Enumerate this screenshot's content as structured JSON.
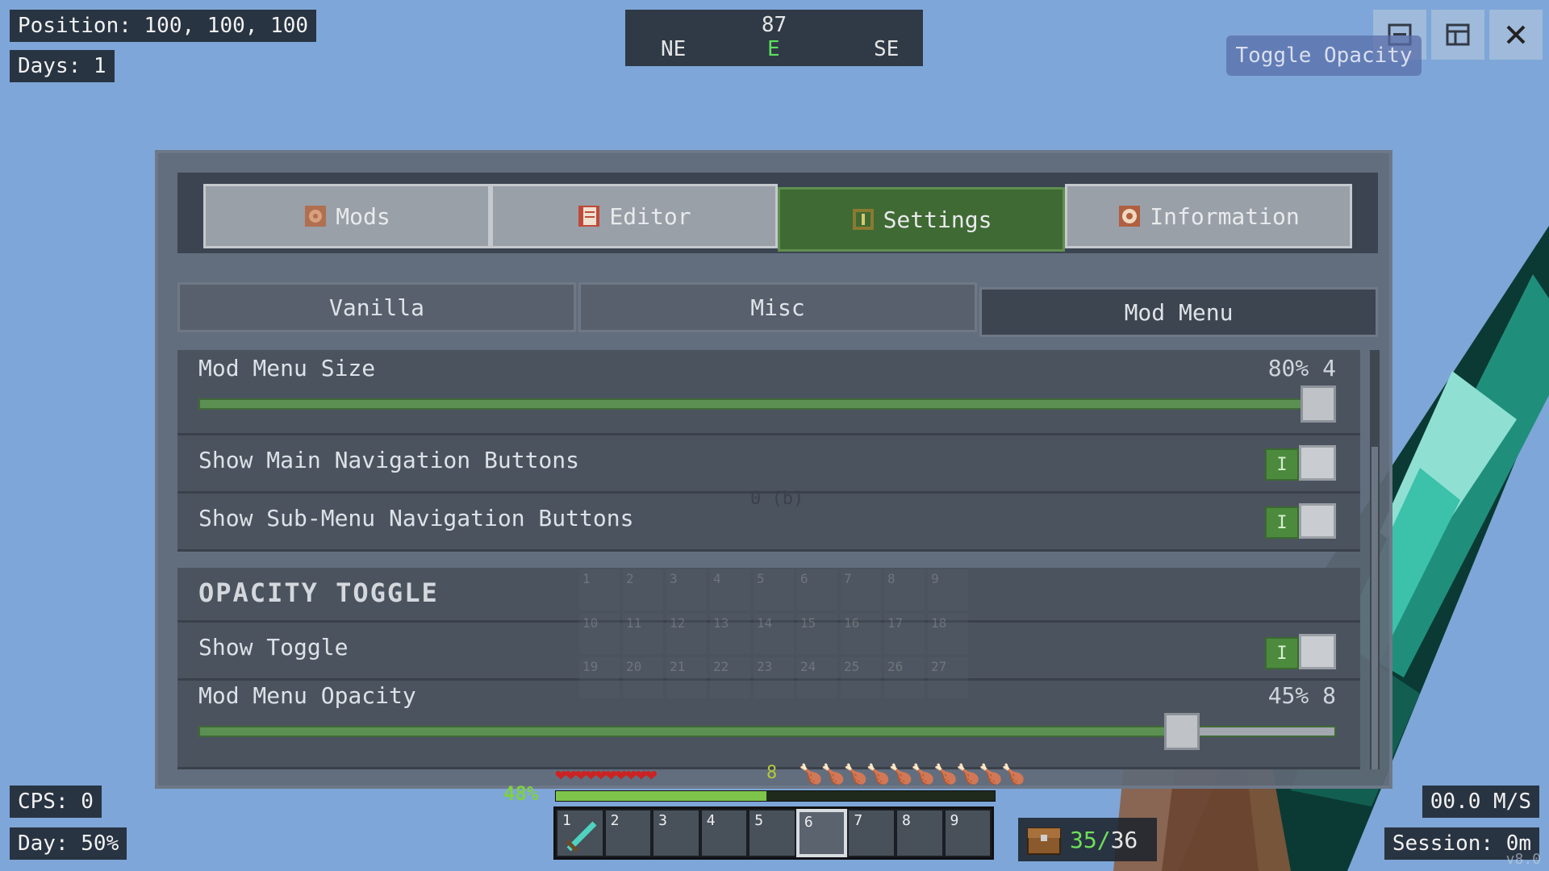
{
  "hud": {
    "position": "Position: 100, 100, 100",
    "days": "Days: 1",
    "cps": "CPS:  0",
    "day": "Day:    50%",
    "speed": "00.0 M/S",
    "session": "Session:   0m",
    "version": "v8.0"
  },
  "compass": {
    "heading": "87",
    "left": "NE",
    "center": "E",
    "right": "SE"
  },
  "window": {
    "toggle_opacity": "Toggle Opacity"
  },
  "main_tabs": [
    {
      "label": "Mods",
      "icon": "mods-icon"
    },
    {
      "label": "Editor",
      "icon": "editor-icon"
    },
    {
      "label": "Settings",
      "icon": "settings-icon"
    },
    {
      "label": "Information",
      "icon": "information-icon"
    }
  ],
  "sub_tabs": [
    {
      "label": "Vanilla"
    },
    {
      "label": "Misc"
    },
    {
      "label": "Mod Menu"
    }
  ],
  "settings": {
    "menu_size": {
      "label": "Mod Menu Size",
      "value": "80% 4",
      "level": 1.0
    },
    "main_nav": {
      "label": "Show Main Navigation Buttons",
      "on": "I"
    },
    "sub_nav": {
      "label": "Show Sub-Menu Navigation Buttons",
      "on": "I"
    },
    "section": "OPACITY TOGGLE",
    "show_toggle": {
      "label": "Show Toggle",
      "on": "I"
    },
    "opacity": {
      "label": "Mod Menu Opacity",
      "value": "45% 8",
      "level": 0.88
    },
    "ghost_text": "0 (b)"
  },
  "hotbar": {
    "slots": [
      "1",
      "2",
      "3",
      "4",
      "5",
      "6",
      "7",
      "8",
      "9"
    ],
    "selected_slot": "6",
    "armor": "8",
    "xp_percent": "48%",
    "inventory": "35/36",
    "inventory_used": "35/",
    "inventory_total": "36"
  },
  "ghost_grid": [
    "1",
    "2",
    "3",
    "4",
    "5",
    "6",
    "7",
    "8",
    "9",
    "10",
    "11",
    "12",
    "13",
    "14",
    "15",
    "16",
    "17",
    "18",
    "19",
    "20",
    "21",
    "22",
    "23",
    "24",
    "25",
    "26",
    "27"
  ],
  "colors": {
    "sky": "#7ea6d8",
    "active_tab": "#3f6a34",
    "slider": "#5c8f52",
    "toggle_on": "#4c8a3e"
  }
}
